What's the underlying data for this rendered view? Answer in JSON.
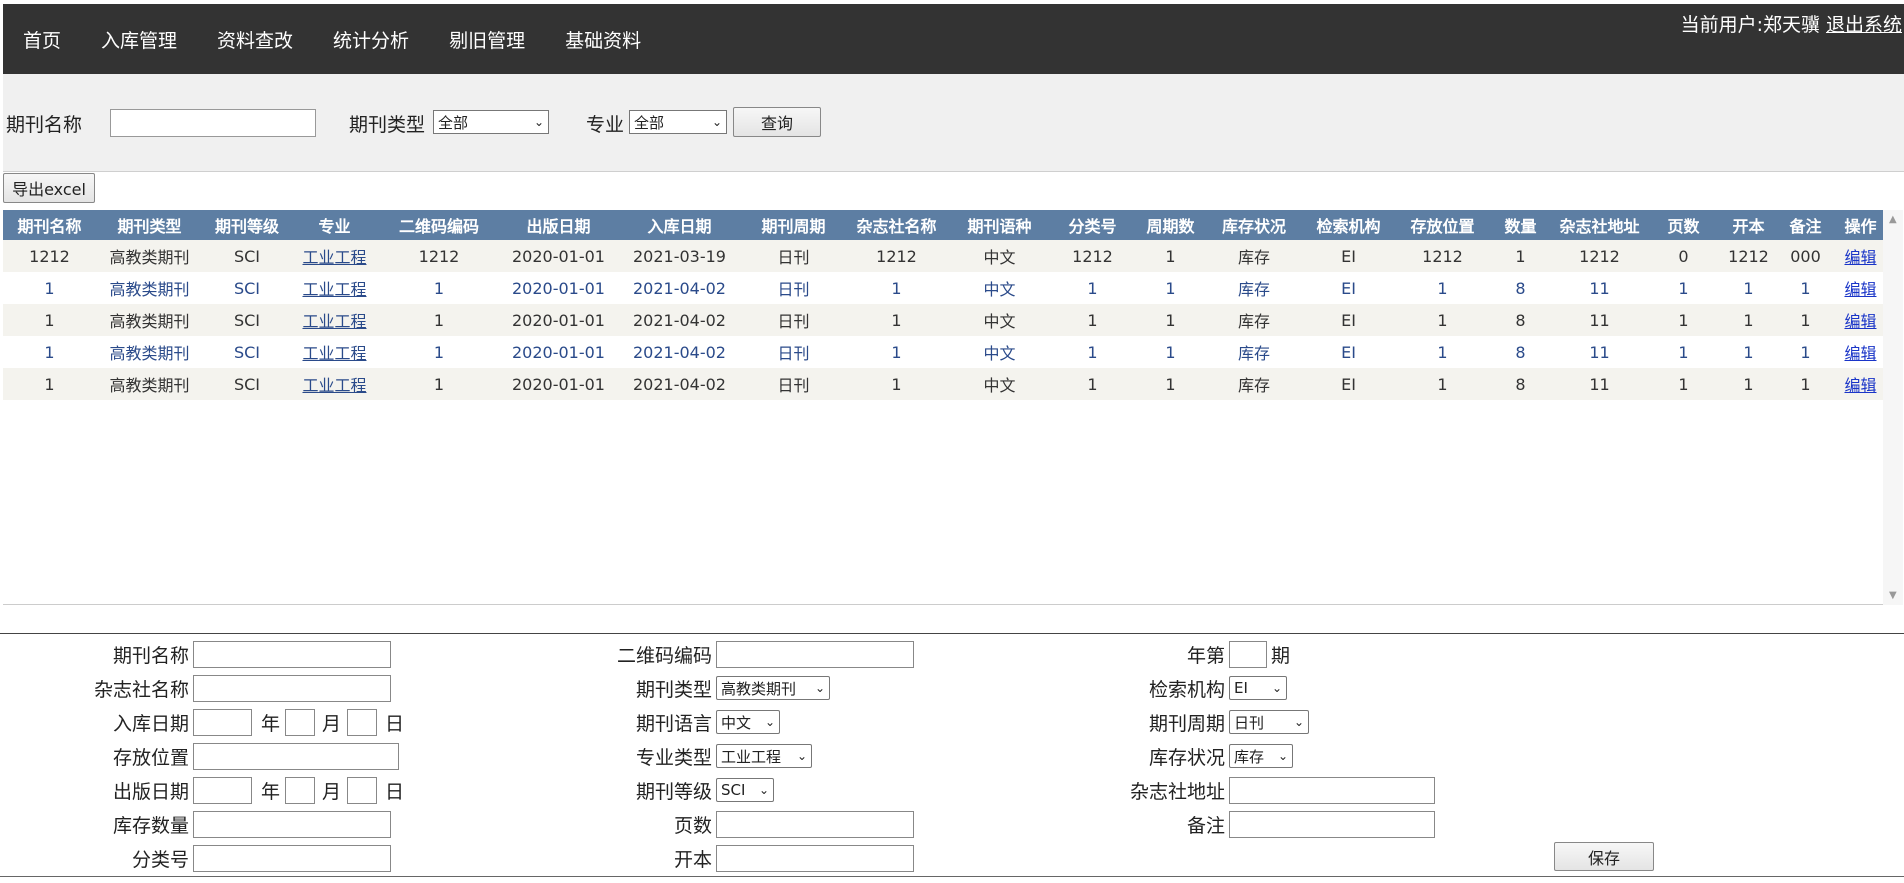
{
  "nav": {
    "items": [
      "首页",
      "入库管理",
      "资料查改",
      "统计分析",
      "剔旧管理",
      "基础资料"
    ],
    "user_label": "当前用户:郑天骥",
    "logout": "退出系统"
  },
  "search": {
    "name_label": "期刊名称",
    "name_value": "",
    "type_label": "期刊类型",
    "type_value": "全部",
    "major_label": "专业",
    "major_value": "全部",
    "query_button": "查询"
  },
  "export_button": "导出excel",
  "table": {
    "headers": [
      "期刊名称",
      "期刊类型",
      "期刊等级",
      "专业",
      "二维码编码",
      "出版日期",
      "入库日期",
      "期刊周期",
      "杂志社名称",
      "期刊语种",
      "分类号",
      "周期数",
      "库存状况",
      "检索机构",
      "存放位置",
      "数量",
      "杂志社地址",
      "页数",
      "开本",
      "备注",
      "操作"
    ],
    "rows": [
      [
        "1212",
        "高教类期刊",
        "SCI",
        "工业工程",
        "1212",
        "2020-01-01",
        "2021-03-19",
        "日刊",
        "1212",
        "中文",
        "1212",
        "1",
        "库存",
        "EI",
        "1212",
        "1",
        "1212",
        "0",
        "1212",
        "000",
        "编辑"
      ],
      [
        "1",
        "高教类期刊",
        "SCI",
        "工业工程",
        "1",
        "2020-01-01",
        "2021-04-02",
        "日刊",
        "1",
        "中文",
        "1",
        "1",
        "库存",
        "EI",
        "1",
        "8",
        "11",
        "1",
        "1",
        "1",
        "编辑"
      ],
      [
        "1",
        "高教类期刊",
        "SCI",
        "工业工程",
        "1",
        "2020-01-01",
        "2021-04-02",
        "日刊",
        "1",
        "中文",
        "1",
        "1",
        "库存",
        "EI",
        "1",
        "8",
        "11",
        "1",
        "1",
        "1",
        "编辑"
      ],
      [
        "1",
        "高教类期刊",
        "SCI",
        "工业工程",
        "1",
        "2020-01-01",
        "2021-04-02",
        "日刊",
        "1",
        "中文",
        "1",
        "1",
        "库存",
        "EI",
        "1",
        "8",
        "11",
        "1",
        "1",
        "1",
        "编辑"
      ],
      [
        "1",
        "高教类期刊",
        "SCI",
        "工业工程",
        "1",
        "2020-01-01",
        "2021-04-02",
        "日刊",
        "1",
        "中文",
        "1",
        "1",
        "库存",
        "EI",
        "1",
        "8",
        "11",
        "1",
        "1",
        "1",
        "编辑"
      ]
    ]
  },
  "form": {
    "name_label": "期刊名称",
    "publisher_label": "杂志社名称",
    "in_date_label": "入库日期",
    "location_label": "存放位置",
    "pub_date_label": "出版日期",
    "stock_qty_label": "库存数量",
    "class_no_label": "分类号",
    "qr_label": "二维码编码",
    "type_label": "期刊类型",
    "type_value": "高教类期刊",
    "lang_label": "期刊语言",
    "lang_value": "中文",
    "major_label": "专业类型",
    "major_value": "工业工程",
    "grade_label": "期刊等级",
    "grade_value": "SCI",
    "pages_label": "页数",
    "format_label": "开本",
    "year_issue_label": "年第",
    "issue_unit": "期",
    "index_label": "检索机构",
    "index_value": "EI",
    "cycle_label": "期刊周期",
    "cycle_value": "日刊",
    "stock_status_label": "库存状况",
    "stock_status_value": "库存",
    "address_label": "杂志社地址",
    "remark_label": "备注",
    "year_unit": "年",
    "month_unit": "月",
    "day_unit": "日",
    "save_button": "保存"
  }
}
